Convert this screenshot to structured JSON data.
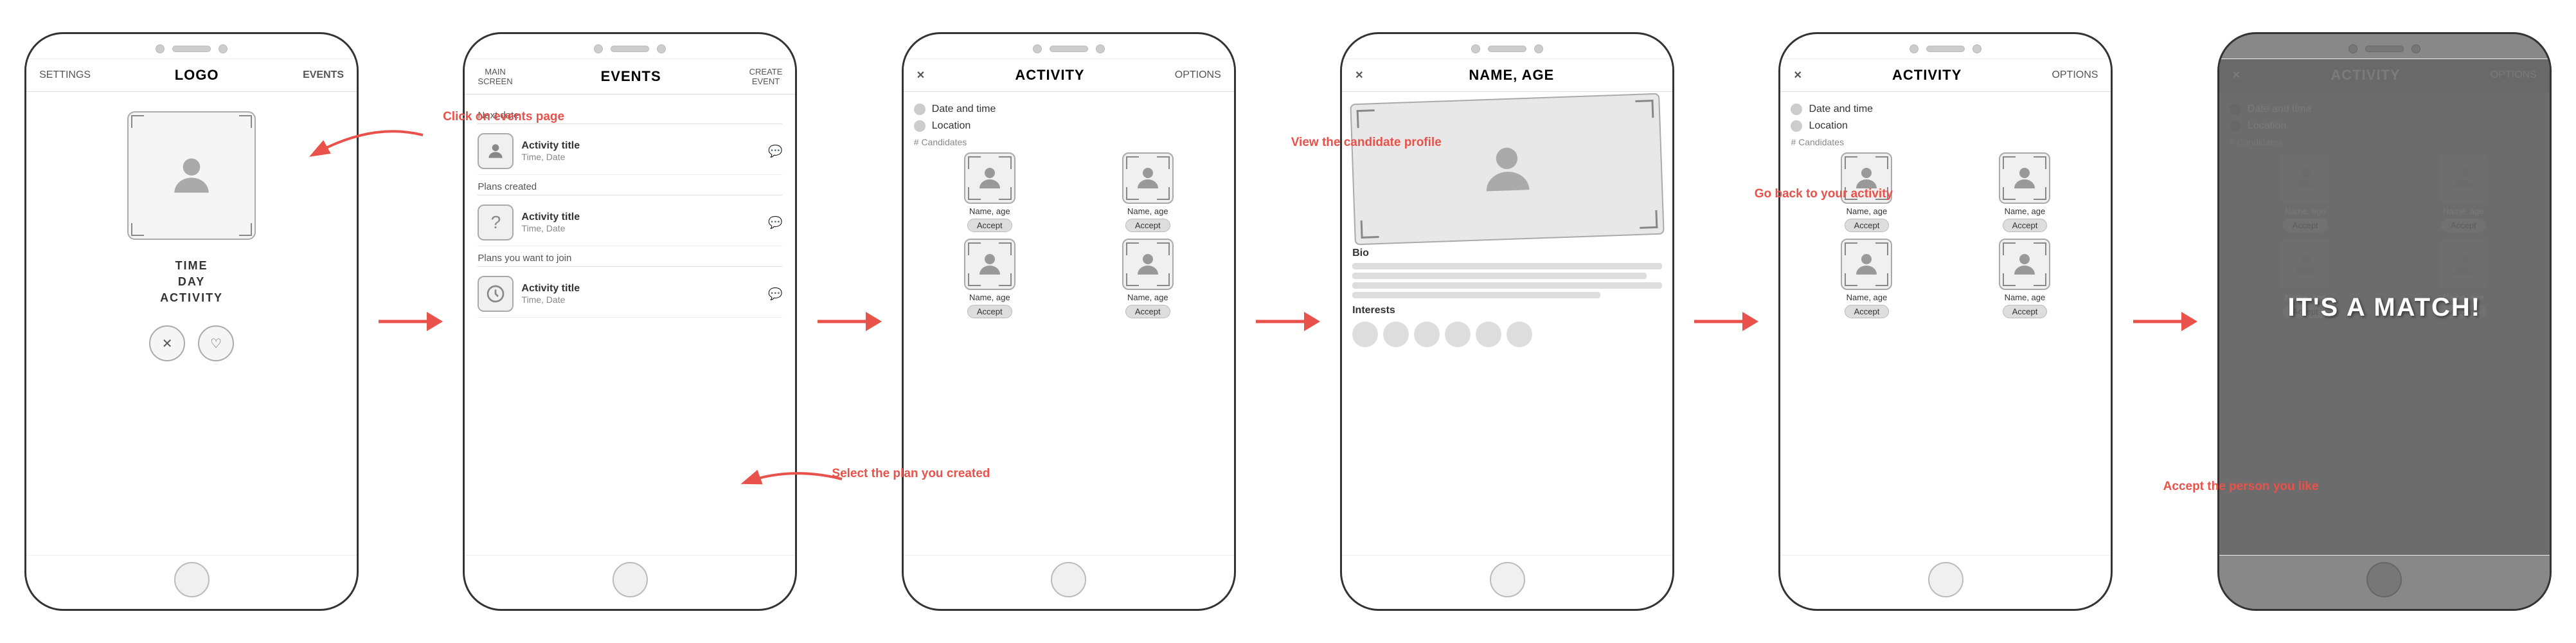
{
  "screens": [
    {
      "id": "screen1",
      "nav": {
        "left": "SETTINGS",
        "center": "LOGO",
        "right": "EVENTS"
      },
      "avatar_label": "avatar-placeholder",
      "info": [
        "TIME",
        "DAY",
        "ACTIVITY"
      ],
      "buttons": [
        "✕",
        "♡"
      ],
      "annotation": "Click on events page"
    },
    {
      "id": "screen2",
      "nav": {
        "left": "MAIN\nSCREEN",
        "center": "EVENTS",
        "right": "CREATE\nEVENT"
      },
      "sections": [
        {
          "label": "Next date",
          "items": [
            {
              "icon": "person",
              "title": "Activity title",
              "sub": "Time, Date"
            }
          ]
        },
        {
          "label": "Plans created",
          "items": [
            {
              "icon": "question",
              "title": "Activity title",
              "sub": "Time, Date"
            }
          ]
        },
        {
          "label": "Plans you want to join",
          "items": [
            {
              "icon": "clock",
              "title": "Activity title",
              "sub": "Time, Date"
            }
          ]
        }
      ],
      "annotation": "Select the plan you created"
    },
    {
      "id": "screen3",
      "nav": {
        "left": "✕",
        "center": "ACTIVITY",
        "right": "OPTIONS"
      },
      "filters": [
        "Date and time",
        "Location"
      ],
      "candidates_label": "# Candidates",
      "candidates": [
        {
          "name": "Name, age",
          "show_accept": true
        },
        {
          "name": "Name, age",
          "show_accept": true
        },
        {
          "name": "Name, age",
          "show_accept": true
        },
        {
          "name": "Name, age",
          "show_accept": true
        }
      ],
      "annotation": "View the candidate profile"
    },
    {
      "id": "screen4",
      "nav": {
        "left": "✕",
        "center": "NAME, AGE",
        "right": ""
      },
      "bio_label": "Bio",
      "bio_lines": 4,
      "interests_label": "Interests",
      "interest_dots": 6,
      "annotation": "Go back to your activity"
    },
    {
      "id": "screen5",
      "nav": {
        "left": "✕",
        "center": "ACTIVITY",
        "right": "OPTIONS"
      },
      "filters": [
        "Date and time",
        "Location"
      ],
      "candidates_label": "# Candidates",
      "candidates": [
        {
          "name": "Name, age",
          "show_accept": true
        },
        {
          "name": "Name, age",
          "show_accept": true
        },
        {
          "name": "Name, age",
          "show_accept": true
        },
        {
          "name": "Name, age",
          "show_accept": true
        }
      ],
      "annotation": "Accept the person you like"
    },
    {
      "id": "screen6",
      "dark": true,
      "nav": {
        "left": "✕",
        "center": "ACTIVITY",
        "right": "OPTIONS"
      },
      "filters": [
        "Date and time",
        "Location"
      ],
      "candidates_label": "# Candidates",
      "candidates": [
        {
          "name": "Name, age",
          "show_accept": true
        },
        {
          "name": "Name, age",
          "show_accept": true
        },
        {
          "name": "Name, age",
          "show_accept": true
        },
        {
          "name": "Name, age",
          "show_accept": true
        }
      ],
      "match_text": "IT'S A MATCH!"
    }
  ],
  "arrow_labels": [
    "Click on events page",
    "Select the plan you created",
    "View the candidate profile",
    "Go back to your activity",
    "Accept the person you like"
  ],
  "colors": {
    "arrow": "#e8524a",
    "border": "#333",
    "bg": "#fff",
    "dark_bg": "#888",
    "text_dark": "#333",
    "text_light": "#fff"
  }
}
